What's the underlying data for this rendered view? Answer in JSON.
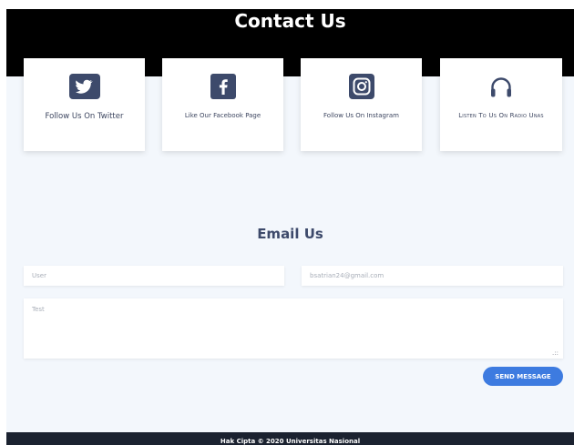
{
  "header": {
    "title": "Contact Us"
  },
  "cards": [
    {
      "icon": "twitter-icon",
      "label": "Follow Us On Twitter"
    },
    {
      "icon": "facebook-icon",
      "label": "Like Our Facebook Page"
    },
    {
      "icon": "instagram-icon",
      "label": "Follow Us On Instagram"
    },
    {
      "icon": "headphones-icon",
      "label": "Listen To Us On Radio Unas"
    }
  ],
  "email_section": {
    "title": "Email Us",
    "user_placeholder": "User",
    "email_placeholder": "bsatrian24@gmail.com",
    "message_placeholder": "Test",
    "send_label": "SEND MESSAGE"
  },
  "footer": {
    "text": "Hak Cipta © 2020 Universitas Nasional"
  },
  "colors": {
    "header_bg": "#000000",
    "page_bg": "#f3f7fc",
    "icon_tile": "#3d4a6b",
    "button": "#3d7be0",
    "footer_bg": "#1b2230"
  }
}
